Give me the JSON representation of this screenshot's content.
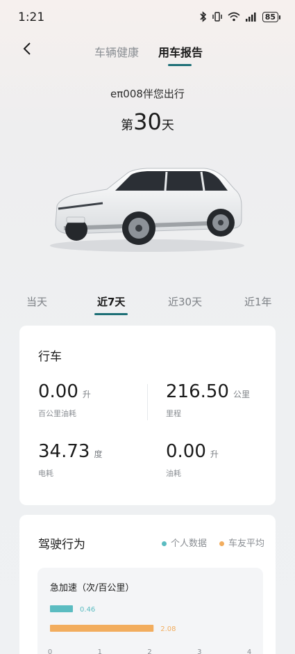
{
  "status": {
    "time": "1:21",
    "battery": "85"
  },
  "nav": {
    "tabs": [
      "车辆健康",
      "用车报告"
    ],
    "active": 1
  },
  "headline": "eπ008伴您出行",
  "days": {
    "prefix": "第",
    "value": "30",
    "suffix": "天"
  },
  "period_tabs": [
    "当天",
    "近7天",
    "近30天",
    "近1年"
  ],
  "driving": {
    "title": "行车",
    "stats": [
      {
        "value": "0.00",
        "unit": "升",
        "label": "百公里油耗"
      },
      {
        "value": "216.50",
        "unit": "公里",
        "label": "里程"
      },
      {
        "value": "34.73",
        "unit": "度",
        "label": "电耗"
      },
      {
        "value": "0.00",
        "unit": "升",
        "label": "油耗"
      }
    ]
  },
  "behavior": {
    "title": "驾驶行为",
    "legend": [
      {
        "label": "个人数据",
        "color": "#5bbcc1"
      },
      {
        "label": "车友平均",
        "color": "#f2ad5e"
      }
    ],
    "metric_title": "急加速（次/百公里）"
  },
  "chart_data": {
    "type": "bar",
    "orientation": "horizontal",
    "categories": [
      "个人数据",
      "车友平均"
    ],
    "values": [
      0.46,
      2.08
    ],
    "data_labels": [
      "0.46",
      "2.08"
    ],
    "xlim": [
      0,
      4
    ],
    "x_ticks": [
      "0",
      "1",
      "2",
      "3",
      "4"
    ],
    "colors": [
      "#5bbcc1",
      "#f2ad5e"
    ]
  }
}
